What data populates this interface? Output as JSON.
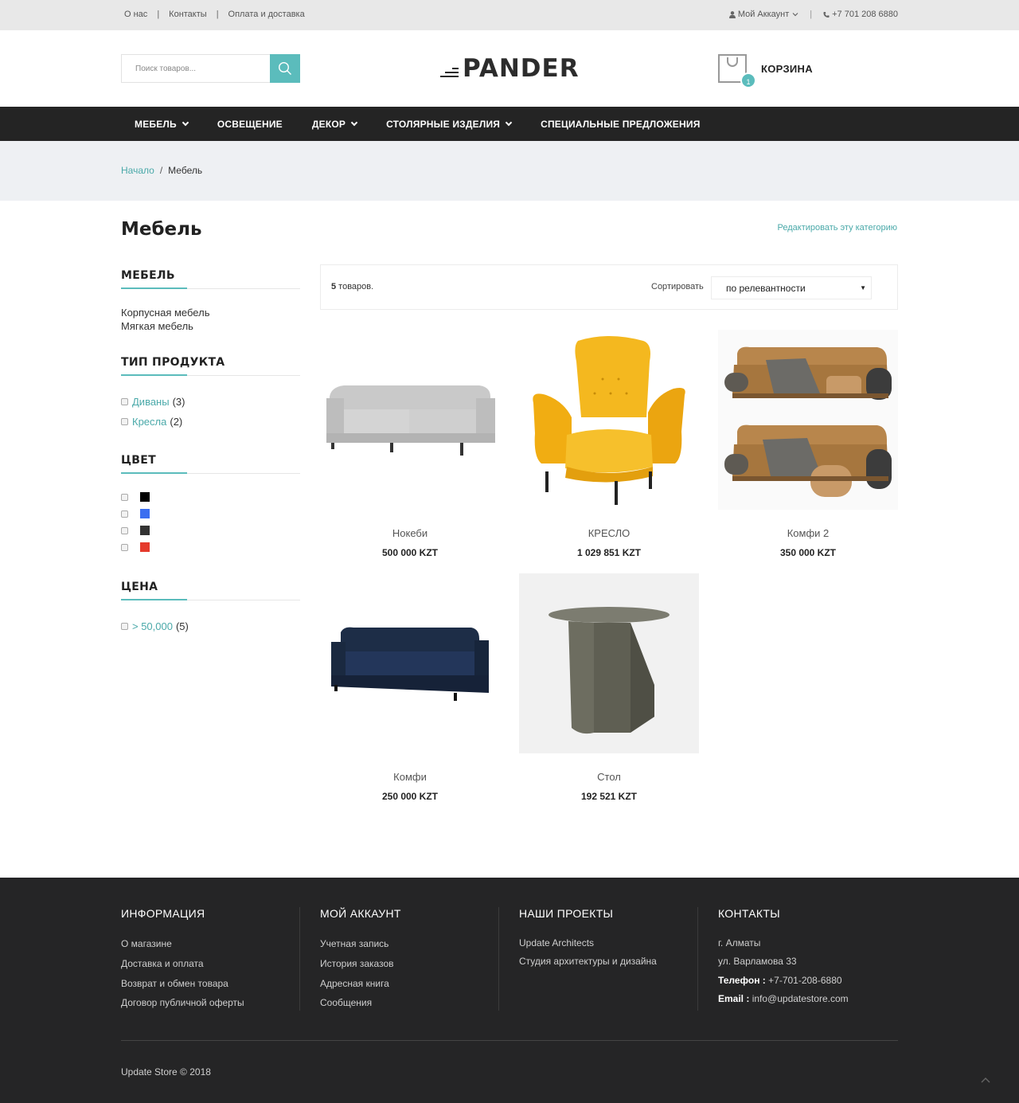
{
  "topbar": {
    "links": [
      "О нас",
      "Контакты",
      "Оплата и доставка"
    ],
    "account": "Мой Аккаунт",
    "phone": "+7 701 208 6880"
  },
  "header": {
    "search_placeholder": "Поиск товаров...",
    "logo": "PANDER",
    "cart_label": "КОРЗИНА",
    "cart_count": "1"
  },
  "nav": {
    "items": [
      {
        "label": "МЕБЕЛЬ",
        "has_dropdown": true
      },
      {
        "label": "ОСВЕЩЕНИЕ",
        "has_dropdown": false
      },
      {
        "label": "ДЕКОР",
        "has_dropdown": true
      },
      {
        "label": "СТОЛЯРНЫЕ ИЗДЕЛИЯ",
        "has_dropdown": true
      },
      {
        "label": "СПЕЦИАЛЬНЫЕ ПРЕДЛОЖЕНИЯ",
        "has_dropdown": false
      }
    ]
  },
  "breadcrumb": {
    "home": "Начало",
    "current": "Мебель"
  },
  "page": {
    "title": "Мебель",
    "edit_link": "Редактировать эту категорию"
  },
  "sidebar": {
    "category": {
      "title": "МЕБЕЛЬ",
      "links": [
        "Корпусная мебель",
        "Мягкая мебель"
      ]
    },
    "type": {
      "title": "ТИП ПРОДУКТА",
      "items": [
        {
          "label": "Диваны",
          "count": "(3)"
        },
        {
          "label": "Кресла",
          "count": "(2)"
        }
      ]
    },
    "color": {
      "title": "ЦВЕТ",
      "swatches": [
        "#000000",
        "#3b6ef0",
        "#333333",
        "#e53a2c"
      ]
    },
    "price": {
      "title": "ЦЕНА",
      "items": [
        {
          "label": "> 50,000",
          "count": "(5)"
        }
      ]
    }
  },
  "toolbar": {
    "count_number": "5",
    "count_text": " товаров.",
    "sort_label": "Сортировать",
    "sort_value": "по релевантности"
  },
  "products": [
    {
      "name": "Нокеби",
      "price": "500 000 KZT",
      "image": "grey-sofa"
    },
    {
      "name": "КРЕСЛО",
      "price": "1 029 851 KZT",
      "image": "yellow-armchair"
    },
    {
      "name": "Комфи 2",
      "price": "350 000 KZT",
      "image": "brown-sofa-set"
    },
    {
      "name": "Комфи",
      "price": "250 000 KZT",
      "image": "navy-sofa"
    },
    {
      "name": "Стол",
      "price": "192 521 KZT",
      "image": "side-table"
    }
  ],
  "footer": {
    "info": {
      "title": "ИНФОРМАЦИЯ",
      "links": [
        "О магазине",
        "Доставка и оплата",
        "Возврат и обмен товара",
        "Договор публичной оферты"
      ]
    },
    "account": {
      "title": "МОЙ АККАУНТ",
      "links": [
        "Учетная запись",
        "История заказов",
        "Адресная книга",
        "Сообщения"
      ]
    },
    "projects": {
      "title": "НАШИ ПРОЕКТЫ",
      "main": "Update Architects",
      "sub": "Студия архитектуры и дизайна"
    },
    "contacts": {
      "title": "КОНТАКТЫ",
      "city": "г. Алматы",
      "street": "ул. Варламова 33",
      "phone_label": "Телефон :",
      "phone": "+7-701-208-6880",
      "email_label": "Email :",
      "email": "info@updatestore.com"
    },
    "copyright": "Update Store © 2018"
  },
  "colors": {
    "accent": "#5bbcbc",
    "nav_bg": "#242424",
    "footer_bg": "#252526",
    "crumb_bg": "#eef0f3"
  }
}
